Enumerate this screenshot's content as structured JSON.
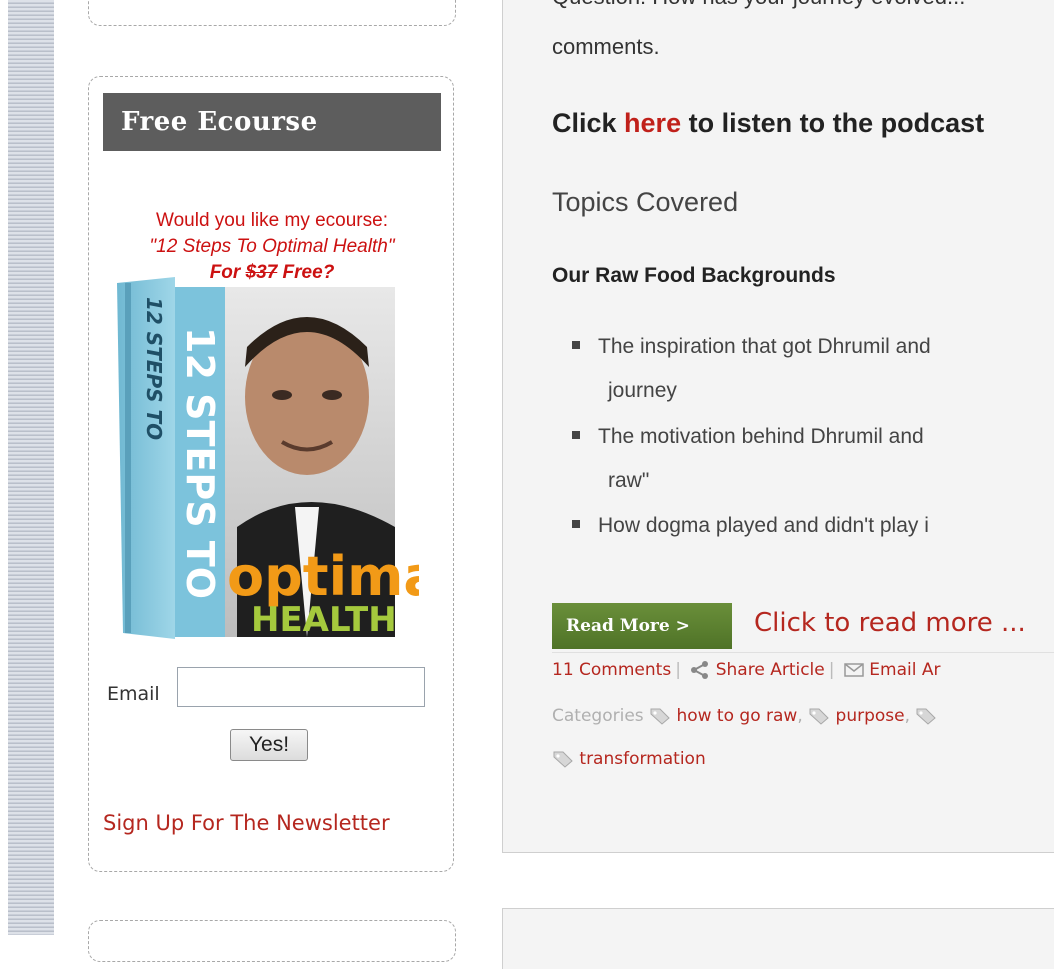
{
  "sidebar": {
    "widget_title": "Free Ecourse",
    "offer_line1": "Would you like my ecourse:",
    "offer_line2": "\"12 Steps To Optimal Health\"",
    "offer_line3_prefix": "For ",
    "offer_line3_price": "$37",
    "offer_line3_suffix": " Free?",
    "book": {
      "spine_text": "12 STEPS TO",
      "cover_text_1": "12 STEPS TO",
      "cover_text_2": "optimal",
      "cover_text_3": "HEALTH"
    },
    "email_label": "Email",
    "email_value": "",
    "yes_button": "Yes!",
    "signup_link": "Sign Up For The Newsletter"
  },
  "post": {
    "cut_line": "Question: How has your journey evolved...",
    "comments_line": "comments.",
    "click_prefix": "Click ",
    "click_link": "here",
    "click_suffix": " to listen to the podcast",
    "topics_heading": "Topics Covered",
    "section_heading": "Our Raw Food Backgrounds",
    "bullets": [
      {
        "line1": "The inspiration that got Dhrumil and",
        "line2": "journey"
      },
      {
        "line1": "The motivation behind Dhrumil and",
        "line2": "raw\""
      },
      {
        "line1": "How dogma played and didn't play i",
        "line2": ""
      }
    ],
    "read_more_button": "Read More >",
    "read_more_text": "Click to read more ...",
    "comments_count": "11 Comments",
    "share_label": "Share Article",
    "email_article_label": "Email Ar",
    "categories_label": "Categories",
    "categories": [
      "how to go raw",
      "purpose",
      "transformation"
    ]
  },
  "colors": {
    "link_red": "#b5271f",
    "offer_red": "#cc1111",
    "title_bar": "#5d5d5d",
    "button_green": "#5a7e30"
  }
}
